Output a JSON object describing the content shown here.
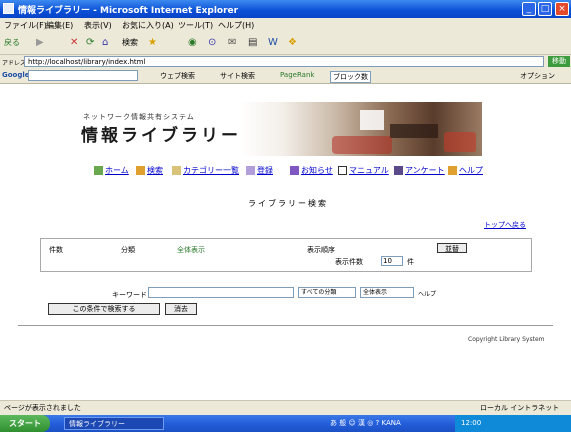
{
  "window": {
    "title": "情報ライブラリー - Microsoft Internet Explorer",
    "min": "_",
    "max": "□",
    "close": "×"
  },
  "menu": {
    "items": [
      "ファイル(F)",
      "編集(E)",
      "表示(V)",
      "お気に入り(A)",
      "ツール(T)",
      "ヘルプ(H)"
    ]
  },
  "toolbar": {
    "back": "戻る",
    "forward": "▶",
    "stop": "✕",
    "refresh": "⟳",
    "home": "⌂",
    "search": "検索",
    "favorites": "★",
    "media": "◉",
    "history": "⊙",
    "mail": "✉",
    "print": "▤",
    "edit": "W",
    "messenger": "❖"
  },
  "address": {
    "label": "アドレス",
    "url": "http://localhost/library/index.html",
    "go": "移動"
  },
  "googlebar": {
    "label": "Google",
    "items": [
      "ウェブ検索",
      "サイト検索",
      "PageRank",
      "ブロック数",
      "オプション"
    ]
  },
  "brand": {
    "subtitle": "ネットワーク情報共有システム",
    "title": "情報ライブラリー"
  },
  "nav": {
    "items": [
      {
        "label": "ホーム"
      },
      {
        "label": "検索"
      },
      {
        "label": "カテゴリー一覧"
      },
      {
        "label": "登録"
      },
      {
        "label": "お知らせ"
      },
      {
        "label": "マニュアル"
      },
      {
        "label": "アンケート"
      },
      {
        "label": "ヘルプ"
      }
    ]
  },
  "section": {
    "title": "ライブラリー検索",
    "top_link": "トップへ戻る"
  },
  "results": {
    "col1": "件数",
    "col2": "分類",
    "col3": "全体表示",
    "col4": "表示順序",
    "sort_button": "並替",
    "count_label": "表示件数",
    "count_value": "10",
    "count_unit": "件"
  },
  "search": {
    "keyword_label": "キーワード",
    "keyword_value": "",
    "category_value": "すべての分類",
    "sub_value": "全体表示",
    "extra": "ヘルプ",
    "search_button": "この条件で検索する",
    "clear_button": "消去"
  },
  "footer": {
    "copyright": "Copyright Library System"
  },
  "status": {
    "left": "ページが表示されました",
    "right": "ローカル イントラネット"
  },
  "taskbar": {
    "start": "スタート",
    "task": "情報ライブラリー",
    "lang": "あ 般 ☺ 漢 ◎ ? KANA",
    "time": "12:00"
  }
}
